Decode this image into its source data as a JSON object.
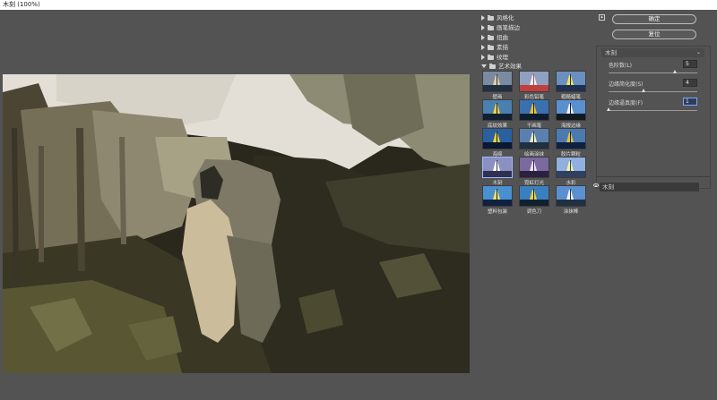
{
  "window": {
    "title": "木刻 (100%)"
  },
  "filter_gallery": {
    "folders": [
      {
        "label": "风格化",
        "expanded": false
      },
      {
        "label": "画笔描边",
        "expanded": false
      },
      {
        "label": "扭曲",
        "expanded": false
      },
      {
        "label": "素描",
        "expanded": false
      },
      {
        "label": "纹理",
        "expanded": false
      },
      {
        "label": "艺术效果",
        "expanded": true
      }
    ],
    "thumbnails": [
      {
        "label": "壁画"
      },
      {
        "label": "彩色铅笔"
      },
      {
        "label": "粗糙蜡笔"
      },
      {
        "label": "底纹效果"
      },
      {
        "label": "干画笔"
      },
      {
        "label": "海报边缘"
      },
      {
        "label": "海绵"
      },
      {
        "label": "绘画涂抹"
      },
      {
        "label": "胶片颗粒"
      },
      {
        "label": "木刻"
      },
      {
        "label": "霓虹灯光"
      },
      {
        "label": "水彩"
      },
      {
        "label": "塑料包装"
      },
      {
        "label": "调色刀"
      },
      {
        "label": "涂抹棒"
      }
    ],
    "selected": "木刻"
  },
  "actions": {
    "ok_label": "确定",
    "reset_label": "复位"
  },
  "settings": {
    "filter_select": "木刻",
    "params": [
      {
        "label": "色阶数(L)",
        "value": "5",
        "fraction": 0.75
      },
      {
        "label": "边缘简化度(S)",
        "value": "4",
        "fraction": 0.4
      },
      {
        "label": "边缘逼真度(F)",
        "value": "1",
        "fraction": 0.0
      }
    ]
  },
  "layers": [
    {
      "label": "木刻",
      "visible": true
    }
  ],
  "colors": {
    "panel": "#535353",
    "selection": "#9fb8ff"
  }
}
